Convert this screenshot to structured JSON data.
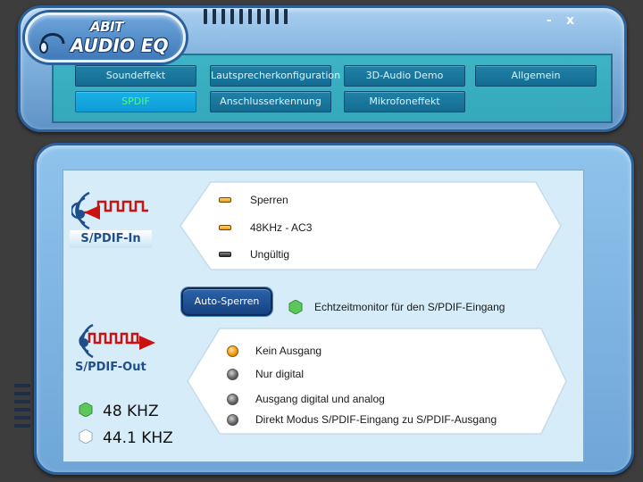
{
  "app": {
    "brand": "ABIT",
    "title": "AUDIO EQ",
    "minimize_label": "-",
    "close_label": "x"
  },
  "tabs": [
    {
      "label": "Soundeffekt",
      "active": false
    },
    {
      "label": "Lautsprecherkonfiguration",
      "active": false
    },
    {
      "label": "3D-Audio Demo",
      "active": false
    },
    {
      "label": "Allgemein",
      "active": false
    },
    {
      "label": "SPDIF",
      "active": true
    },
    {
      "label": "Anschlusserkennung",
      "active": false
    },
    {
      "label": "Mikrofoneffekt",
      "active": false
    }
  ],
  "spdif_in": {
    "label": "S/PDIF-In",
    "icon": "signal-in-icon",
    "options": [
      {
        "label": "Sperren",
        "indicator": "orange"
      },
      {
        "label": "48KHz - AC3",
        "indicator": "orange"
      },
      {
        "label": "Ungültig",
        "indicator": "dark"
      }
    ]
  },
  "auto_lock": {
    "button_label": "Auto-Sperren",
    "monitor_label": "Echtzeitmonitor für den S/PDIF-Eingang",
    "monitor_color": "#5cc85c"
  },
  "spdif_out": {
    "label": "S/PDIF-Out",
    "icon": "signal-out-icon",
    "options": [
      {
        "label": "Kein Ausgang",
        "selected": true
      },
      {
        "label": "Nur digital",
        "selected": false
      },
      {
        "label": "Ausgang digital und analog",
        "selected": false
      },
      {
        "label": "Direkt Modus S/PDIF-Eingang zu S/PDIF-Ausgang",
        "selected": false
      }
    ]
  },
  "frequencies": [
    {
      "label": "48 KHZ",
      "color": "#5cc85c"
    },
    {
      "label": "44.1 KHZ",
      "color": "#ffffff"
    }
  ],
  "colors": {
    "accent_tab_active_text": "#4dff6b",
    "indicator_orange": "#f39a12",
    "icon_red": "#cc1111",
    "icon_blue": "#1f4f8a"
  }
}
